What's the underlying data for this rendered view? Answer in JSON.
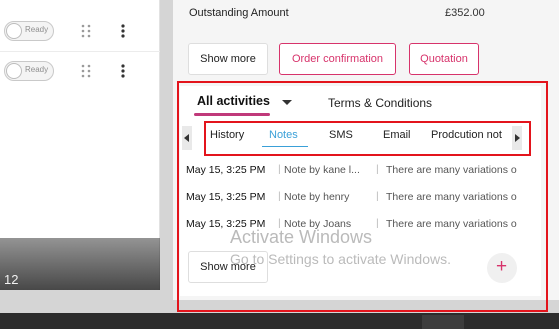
{
  "left_panel": {
    "rows": [
      {
        "status": "Ready"
      },
      {
        "status": "Ready"
      }
    ],
    "page_number": "12"
  },
  "summary": {
    "outstanding_label": "Outstanding Amount",
    "outstanding_value": "£352.00"
  },
  "actions": {
    "show_more": "Show more",
    "order_confirmation": "Order confirmation",
    "quotation": "Quotation"
  },
  "activity": {
    "tabs": [
      {
        "label": "All activities",
        "active": true
      },
      {
        "label": "Terms & Conditions",
        "active": false
      }
    ],
    "sub_tabs": [
      {
        "label": "History",
        "active": false
      },
      {
        "label": "Notes",
        "active": true
      },
      {
        "label": "SMS",
        "active": false
      },
      {
        "label": "Email",
        "active": false
      },
      {
        "label": "Prodcution not",
        "active": false
      }
    ],
    "notes": [
      {
        "date": "May 15, 3:25 PM",
        "author": "Note by  kane l...",
        "text": "There are many variations o"
      },
      {
        "date": "May 15, 3:25 PM",
        "author": "Note by henry",
        "text": "There are many variations o"
      },
      {
        "date": "May 15, 3:25 PM",
        "author": "Note by Joans",
        "text": "There are many variations o"
      }
    ],
    "show_more": "Show more",
    "add_symbol": "+"
  },
  "watermark": {
    "title": "Activate Windows",
    "subtitle": "Go to Settings to activate Windows."
  },
  "colors": {
    "accent": "#d7336b",
    "tab_active": "#3aa0d8",
    "highlight": "#e3141c"
  }
}
